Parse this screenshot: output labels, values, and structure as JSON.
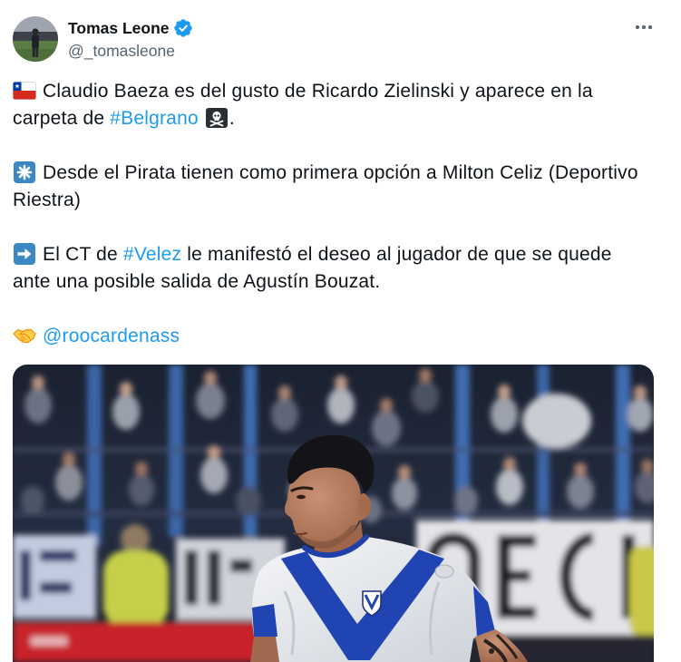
{
  "author": {
    "name": "Tomas Leone",
    "handle": "@_tomasleone",
    "verified": true
  },
  "icons": {
    "avatar": "avatar-photo",
    "verified": "verified-badge-icon",
    "more": "more-options-icon"
  },
  "tweet": {
    "paragraphs": [
      {
        "icon": "chile-flag-icon",
        "lines": [
          [
            {
              "text": "Claudio Baeza es del gusto de Ricardo Zielinski y aparece en la",
              "link": false
            }
          ],
          [
            {
              "text": "carpeta de ",
              "link": false
            },
            {
              "text": "#Belgrano",
              "link": true
            },
            {
              "icon": "pirate-flag-icon"
            },
            {
              "text": ".",
              "link": false
            }
          ]
        ]
      },
      {
        "icon": "eight-spoked-asterisk-icon",
        "lines": [
          [
            {
              "text": "Desde el Pirata tienen como primera opción a Milton Celiz (Deportivo",
              "link": false
            }
          ],
          [
            {
              "text": "Riestra)",
              "link": false
            }
          ]
        ]
      },
      {
        "icon": "right-arrow-icon",
        "lines": [
          [
            {
              "text": "El CT de ",
              "link": false
            },
            {
              "text": "#Velez",
              "link": true
            },
            {
              "text": " le manifestó el deseo al jugador de que se quede",
              "link": false
            }
          ],
          [
            {
              "text": "ante una posible salida de Agustín Bouzat.",
              "link": false
            }
          ]
        ]
      },
      {
        "icon": "handshake-icon",
        "lines": [
          [
            {
              "text": "@roocardenass",
              "link": true
            }
          ]
        ]
      }
    ]
  },
  "theme": {
    "text": "#0f1419",
    "link": "#1d9bf0",
    "secondary": "#536471",
    "verified": "#1d9bf0"
  }
}
